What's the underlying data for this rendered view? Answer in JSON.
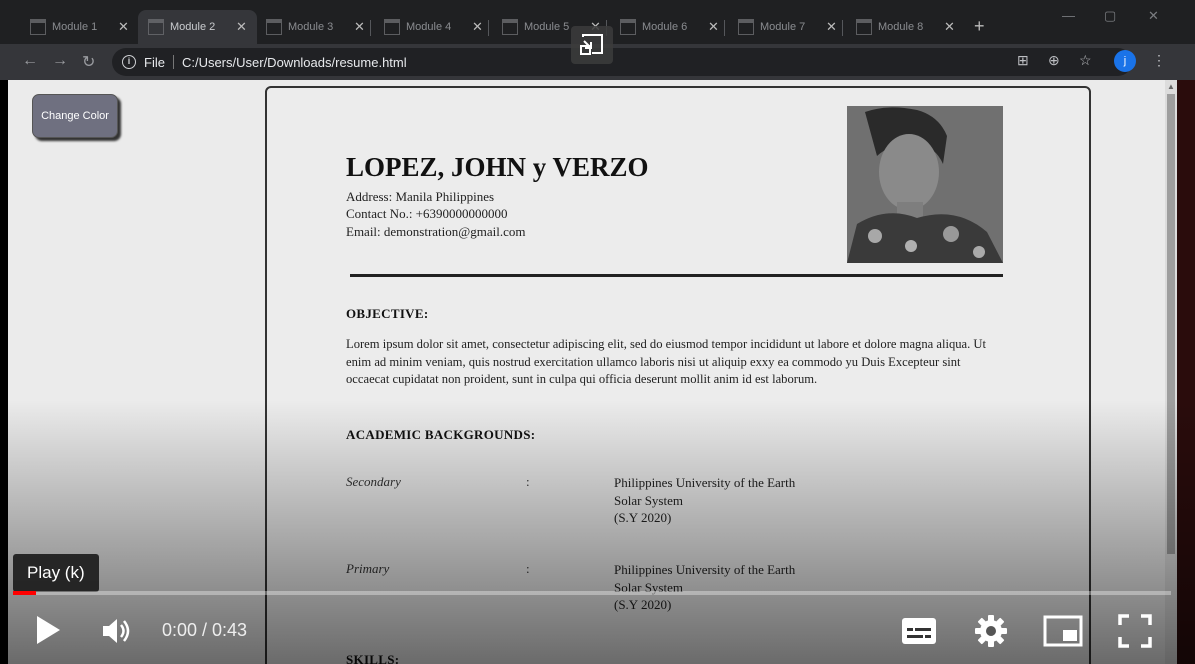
{
  "browser": {
    "tabs": [
      {
        "title": "Module 1",
        "active": false
      },
      {
        "title": "Module 2",
        "active": true
      },
      {
        "title": "Module 3",
        "active": false
      },
      {
        "title": "Module 4",
        "active": false
      },
      {
        "title": "Module 5",
        "active": false
      },
      {
        "title": "Module 6",
        "active": false
      },
      {
        "title": "Module 7",
        "active": false
      },
      {
        "title": "Module 8",
        "active": false
      }
    ],
    "new_tab": "+",
    "url_scheme": "File",
    "url": "C:/Users/User/Downloads/resume.html",
    "profile_initial": "j"
  },
  "page": {
    "change_color_label": "Change Color",
    "resume": {
      "name": "LOPEZ, JOHN y VERZO",
      "address": "Address: Manila Philippines",
      "contact": "Contact No.: +6390000000000",
      "email": "Email: demonstration@gmail.com",
      "objective_title": "OBJECTIVE:",
      "objective_text": "Lorem ipsum dolor sit amet, consectetur adipiscing elit, sed do eiusmod tempor incididunt ut labore et dolore magna aliqua. Ut enim ad minim veniam, quis nostrud exercitation ullamco laboris nisi ut aliquip exxy ea commodo yu Duis Excepteur sint occaecat cupidatat non proident, sunt in culpa qui officia deserunt mollit anim id est laborum.",
      "academic_title": "ACADEMIC BACKGROUNDS:",
      "education": [
        {
          "level": "Secondary",
          "colon": ":",
          "school": "Philippines University of the Earth",
          "location": "Solar System",
          "year": "(S.Y 2020)"
        },
        {
          "level": "Primary",
          "colon": ":",
          "school": "Philippines University of the Earth",
          "location": "Solar System",
          "year": "(S.Y 2020)"
        }
      ],
      "skills_title": "SKILLS:"
    }
  },
  "video": {
    "tooltip": "Play (k)",
    "time": "0:00 / 0:43",
    "progress": 0.02
  },
  "colors": {
    "progress": "#ff0000",
    "button": "#6f7080"
  }
}
